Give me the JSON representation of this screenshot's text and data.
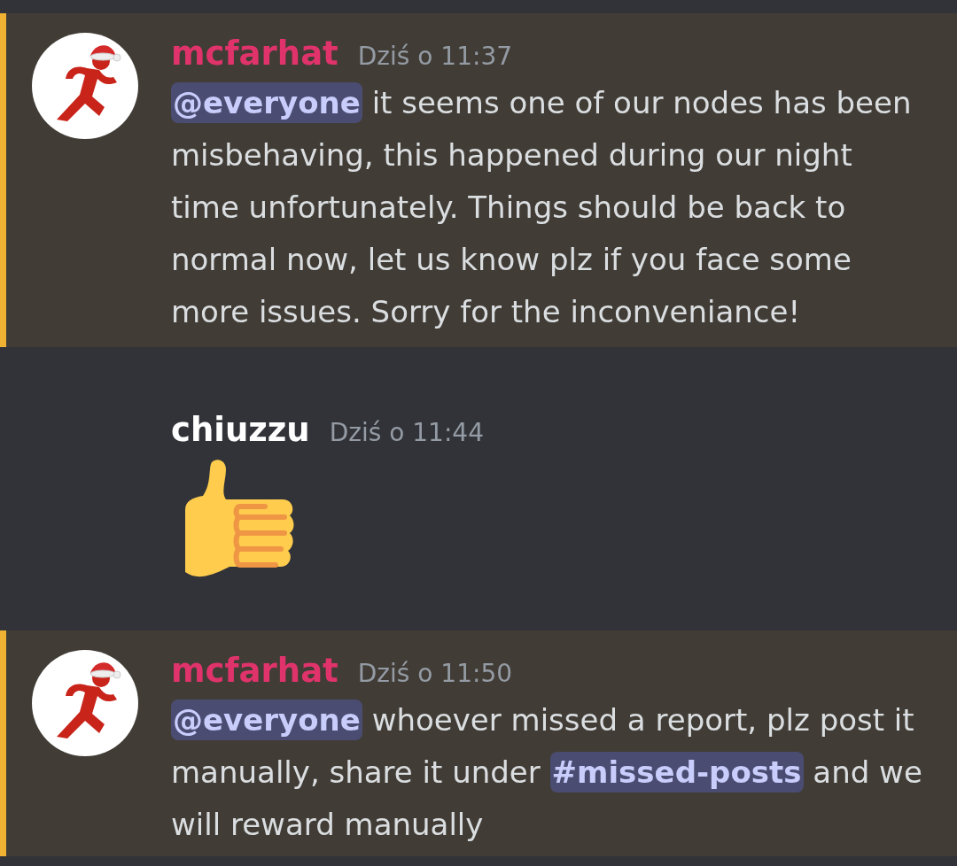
{
  "messages": [
    {
      "author": "mcfarhat",
      "color": "#e0336b",
      "timestamp": "Dziś o 11:37",
      "highlighted": true,
      "avatar": true,
      "content": {
        "kind": "text",
        "parts": [
          {
            "kind": "mention",
            "text": "@everyone"
          },
          {
            "kind": "plain",
            "text": " it seems one of our nodes has been misbehaving, this happened during our night time unfortunately. Things should be back to normal now, let us know plz if you face some more issues. Sorry for the inconveniance!"
          }
        ]
      }
    },
    {
      "author": "chiuzzu",
      "color": "#ffffff",
      "timestamp": "Dziś o 11:44",
      "highlighted": false,
      "avatar": false,
      "content": {
        "kind": "emoji"
      }
    },
    {
      "author": "mcfarhat",
      "color": "#e0336b",
      "timestamp": "Dziś o 11:50",
      "highlighted": true,
      "avatar": true,
      "content": {
        "kind": "text",
        "parts": [
          {
            "kind": "mention",
            "text": "@everyone"
          },
          {
            "kind": "plain",
            "text": " whoever missed a report, plz post it manually, share it under "
          },
          {
            "kind": "channel",
            "text": "#missed-posts"
          },
          {
            "kind": "plain",
            "text": " and we will reward manually"
          }
        ]
      }
    }
  ]
}
